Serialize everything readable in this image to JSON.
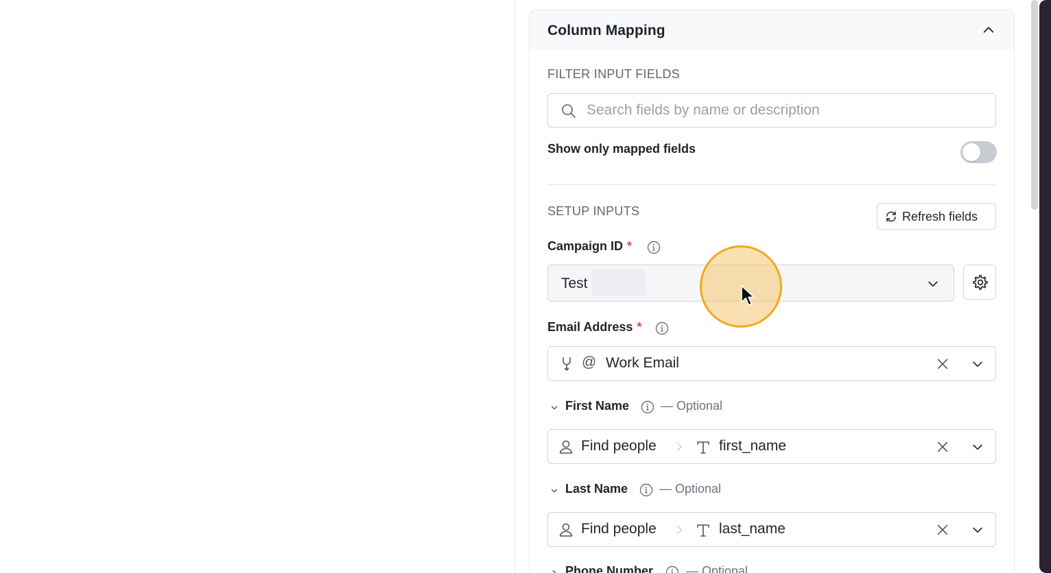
{
  "panel": {
    "title": "Column Mapping",
    "filter": {
      "section_label": "FILTER INPUT FIELDS",
      "search_placeholder": "Search fields by name or description",
      "search_value": "",
      "toggle_label": "Show only mapped fields",
      "toggle_on": false
    },
    "setup": {
      "section_label": "SETUP INPUTS",
      "refresh_label": "Refresh fields"
    },
    "fields": {
      "campaign_id": {
        "label": "Campaign ID",
        "required_mark": "*",
        "value": "Test"
      },
      "email_address": {
        "label": "Email Address",
        "required_mark": "*",
        "value": "Work Email"
      },
      "first_name": {
        "label": "First Name",
        "optional": "— Optional",
        "source": "Find people",
        "value": "first_name"
      },
      "last_name": {
        "label": "Last Name",
        "optional": "— Optional",
        "source": "Find people",
        "value": "last_name"
      },
      "phone_number": {
        "label": "Phone Number",
        "optional": "— Optional"
      }
    }
  },
  "colors": {
    "required": "#e5484d",
    "cursor_highlight": "#f2a81d",
    "toggle_off": "#c8ccd2"
  },
  "icons": [
    "chevron-up-icon",
    "search-icon",
    "refresh-icon",
    "info-icon",
    "chevron-down-icon",
    "gear-icon",
    "merge-icon",
    "at-icon",
    "person-icon",
    "text-type-icon",
    "chevron-right-icon",
    "close-icon",
    "cursor-arrow-icon"
  ]
}
